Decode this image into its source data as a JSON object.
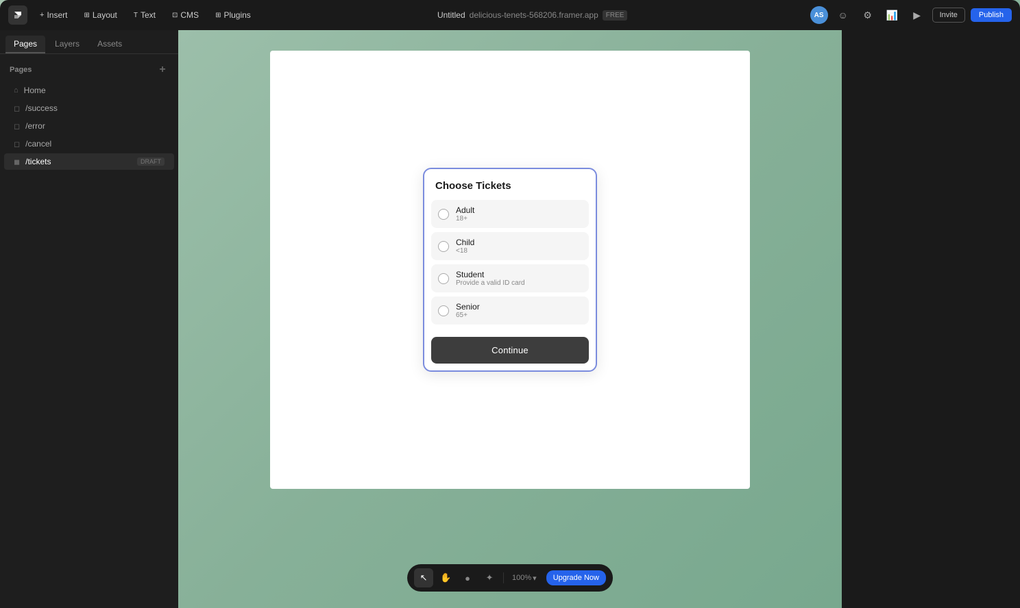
{
  "topbar": {
    "logo": "F",
    "menu_items": [
      {
        "label": "Insert",
        "icon": "plus-icon"
      },
      {
        "label": "Layout",
        "icon": "layout-icon"
      },
      {
        "label": "Text",
        "icon": "text-icon"
      },
      {
        "label": "CMS",
        "icon": "cms-icon"
      },
      {
        "label": "Plugins",
        "icon": "plugins-icon"
      }
    ],
    "project_name": "Untitled",
    "project_url": "delicious-tenets-568206.framer.app",
    "plan_badge": "FREE",
    "avatar_initials": "AS",
    "invite_label": "Invite",
    "publish_label": "Publish"
  },
  "sidebar": {
    "tabs": [
      {
        "label": "Pages",
        "active": true
      },
      {
        "label": "Layers",
        "active": false
      },
      {
        "label": "Assets",
        "active": false
      }
    ],
    "section_title": "Pages",
    "pages": [
      {
        "name": "Home",
        "icon": "home-icon",
        "path": null,
        "draft": false,
        "active": false
      },
      {
        "name": "/success",
        "icon": "page-icon",
        "path": "/success",
        "draft": false,
        "active": false
      },
      {
        "name": "/error",
        "icon": "page-icon",
        "path": "/error",
        "draft": false,
        "active": false
      },
      {
        "name": "/cancel",
        "icon": "page-icon",
        "path": "/cancel",
        "draft": false,
        "active": false
      },
      {
        "name": "/tickets",
        "icon": "page-icon",
        "path": "/tickets",
        "draft": true,
        "active": true
      }
    ]
  },
  "modal": {
    "title": "Choose Tickets",
    "options": [
      {
        "name": "Adult",
        "desc": "18+"
      },
      {
        "name": "Child",
        "desc": "<18"
      },
      {
        "name": "Student",
        "desc": "Provide a valid ID card"
      },
      {
        "name": "Senior",
        "desc": "65+"
      }
    ],
    "continue_label": "Continue"
  },
  "bottom_toolbar": {
    "tools": [
      {
        "name": "cursor-tool",
        "symbol": "↖",
        "active": true
      },
      {
        "name": "hand-tool",
        "symbol": "✋",
        "active": false
      },
      {
        "name": "circle-tool",
        "symbol": "●",
        "active": false
      },
      {
        "name": "light-tool",
        "symbol": "✦",
        "active": false
      }
    ],
    "zoom_level": "100%",
    "zoom_chevron": "▾",
    "upgrade_label": "Upgrade Now"
  }
}
